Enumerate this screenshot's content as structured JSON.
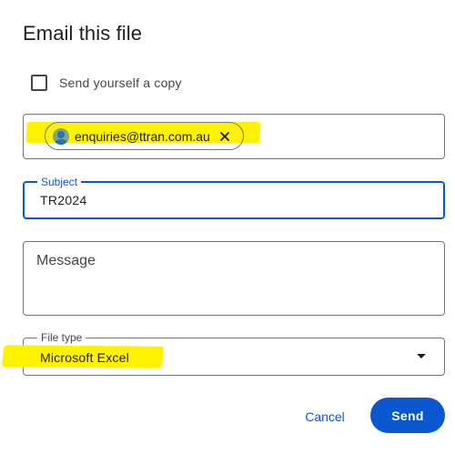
{
  "dialog": {
    "title": "Email this file"
  },
  "send_copy": {
    "label": "Send yourself a copy",
    "checked": false
  },
  "recipients": {
    "chips": [
      {
        "email": "enquiries@ttran.com.au",
        "icon": "person-avatar-icon"
      }
    ],
    "highlight_color": "#fff200"
  },
  "subject": {
    "label": "Subject",
    "value": "TR2024"
  },
  "message": {
    "placeholder": "Message",
    "value": ""
  },
  "file_type": {
    "label": "File type",
    "selected": "Microsoft Excel",
    "icon": "dropdown-arrow-icon"
  },
  "actions": {
    "cancel_label": "Cancel",
    "send_label": "Send"
  },
  "colors": {
    "accent": "#0b57d0",
    "text": "#1f1f1f",
    "border": "#747775",
    "highlight": "#fff200"
  }
}
